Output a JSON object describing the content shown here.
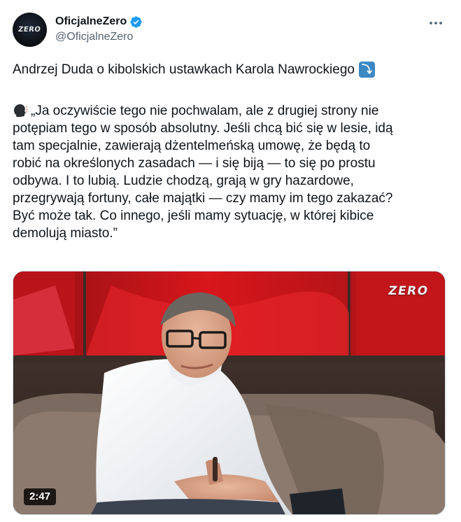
{
  "tweet": {
    "author": {
      "display_name": "OficjalneZero",
      "handle": "@OficjalneZero",
      "avatar_logo": "ZERO",
      "verified": true,
      "verified_color": "#1d9bf0"
    },
    "more_icon": "more-horizontal-icon",
    "headline": "Andrzej Duda o kibolskich ustawkach Karola Nawrockiego",
    "headline_emoji": "⤵",
    "quote_emoji": "speaking-head-icon",
    "quote_lines": [
      "„Ja oczywiście tego nie pochwalam, ale z drugiej strony nie",
      "potępiam tego w sposób absolutny. Jeśli chcą bić się w lesie, idą",
      "tam specjalnie, zawierają dżentelmeńską umowę, że będą to",
      "robić na określonych zasadach — i się biją — to się po prostu",
      "odbywa. I to lubią. Ludzie chodzą, grają w gry hazardowe,",
      "przegrywają fortuny, całe majątki — czy mamy im tego zakazać?",
      "Być może tak. Co innego, jeśli mamy sytuację, w której kibice",
      "demolują miasto.”"
    ],
    "video": {
      "logo": "ZERO",
      "duration": "2:47",
      "accent_color": "#d8161b"
    }
  }
}
